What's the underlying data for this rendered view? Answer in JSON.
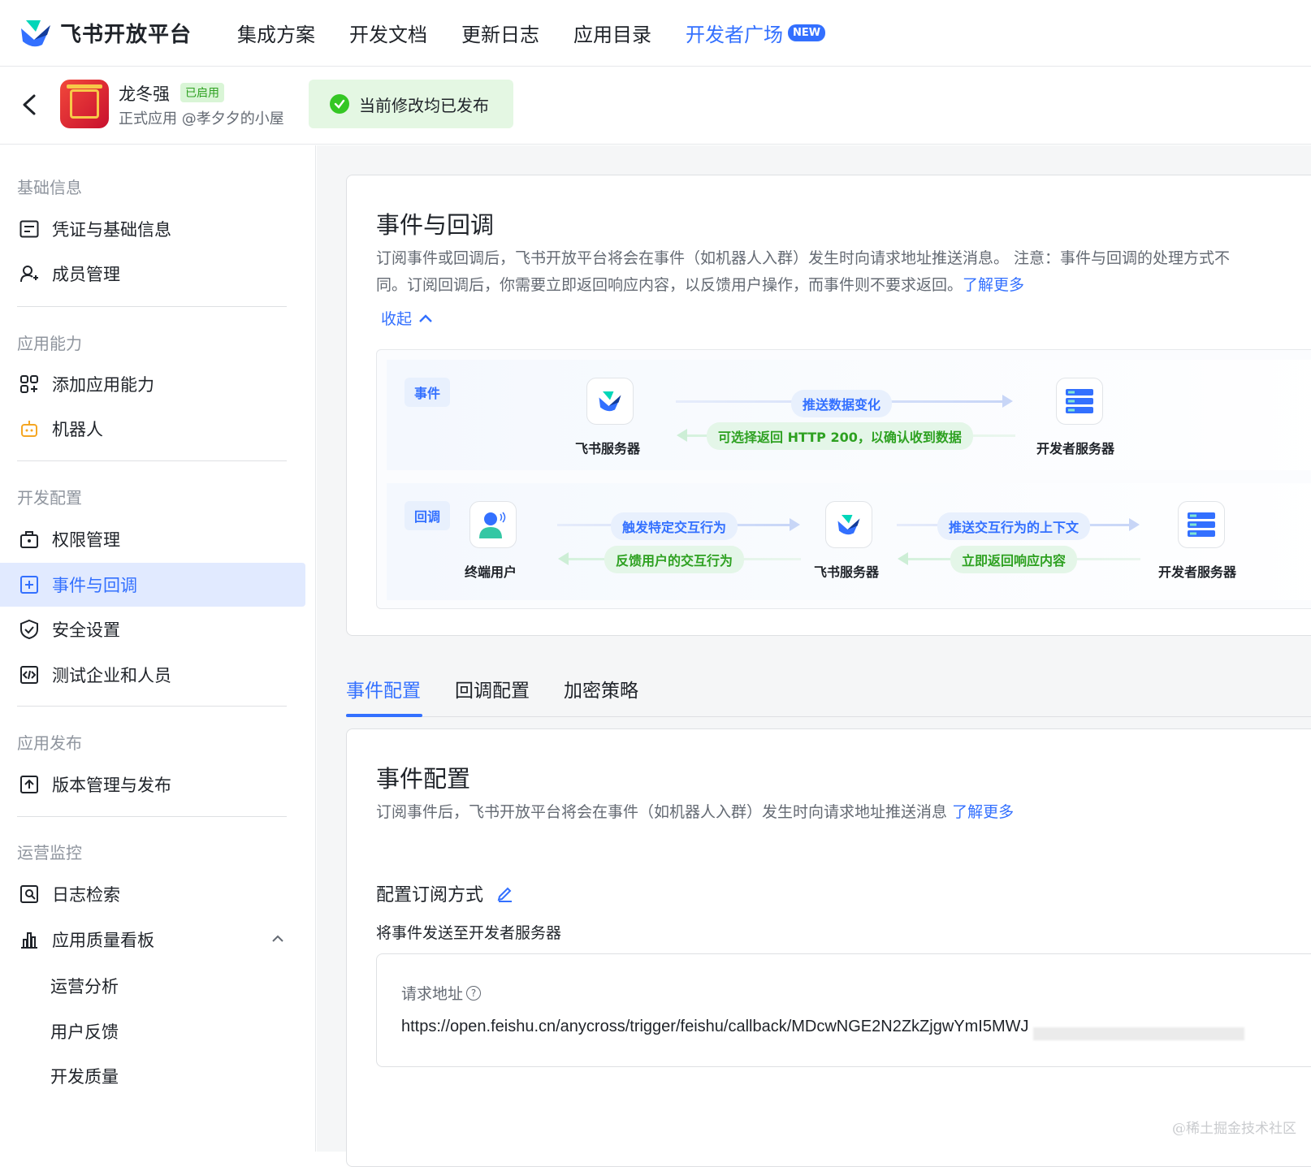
{
  "topnav": {
    "brand": "飞书开放平台",
    "items": [
      "集成方案",
      "开发文档",
      "更新日志",
      "应用目录"
    ],
    "developer": "开发者广场",
    "new_badge": "NEW"
  },
  "app": {
    "name": "龙冬强",
    "status": "已启用",
    "subtitle": "正式应用 @孝夕夕的小屋",
    "publish_status": "当前修改均已发布"
  },
  "sidebar": {
    "sections": [
      {
        "title": "基础信息",
        "items": [
          "凭证与基础信息",
          "成员管理"
        ]
      },
      {
        "title": "应用能力",
        "items": [
          "添加应用能力",
          "机器人"
        ]
      },
      {
        "title": "开发配置",
        "items": [
          "权限管理",
          "事件与回调",
          "安全设置",
          "测试企业和人员"
        ]
      },
      {
        "title": "应用发布",
        "items": [
          "版本管理与发布"
        ]
      },
      {
        "title": "运营监控",
        "items": [
          "日志检索",
          "应用质量看板"
        ],
        "subitems": [
          "运营分析",
          "用户反馈",
          "开发质量"
        ]
      }
    ]
  },
  "main": {
    "title": "事件与回调",
    "desc_line1": "订阅事件或回调后，飞书开放平台将会在事件（如机器人入群）发生时向请求地址推送消息。 注意：事件与回调的处理方式不",
    "desc_line2": "同。订阅回调后，你需要立即返回响应内容，以反馈用户操作，而事件则不要求返回。",
    "learn_more": "了解更多",
    "collapse": "收起",
    "diagram": {
      "event_tag": "事件",
      "callback_tag": "回调",
      "feishu_server": "飞书服务器",
      "dev_server": "开发者服务器",
      "end_user": "终端用户",
      "push_data": "推送数据变化",
      "return_200": "可选择返回 HTTP 200，以确认收到数据",
      "trigger": "触发特定交互行为",
      "feedback": "反馈用户的交互行为",
      "push_context": "推送交互行为的上下文",
      "return_now": "立即返回响应内容"
    },
    "tabs": [
      "事件配置",
      "回调配置",
      "加密策略"
    ],
    "event_config": {
      "title": "事件配置",
      "desc": "订阅事件后，飞书开放平台将会在事件（如机器人入群）发生时向请求地址推送消息",
      "learn_more": "了解更多",
      "subscribe_title": "配置订阅方式",
      "send_to": "将事件发送至开发者服务器",
      "url_label": "请求地址",
      "url_value": "https://open.feishu.cn/anycross/trigger/feishu/callback/MDcwNGE2N2ZkZjgwYmI5MWJ"
    }
  },
  "watermark": "@稀土掘金技术社区",
  "colors": {
    "accent": "#3370ff",
    "success": "#34c724",
    "active_bg": "#e1eaff"
  }
}
